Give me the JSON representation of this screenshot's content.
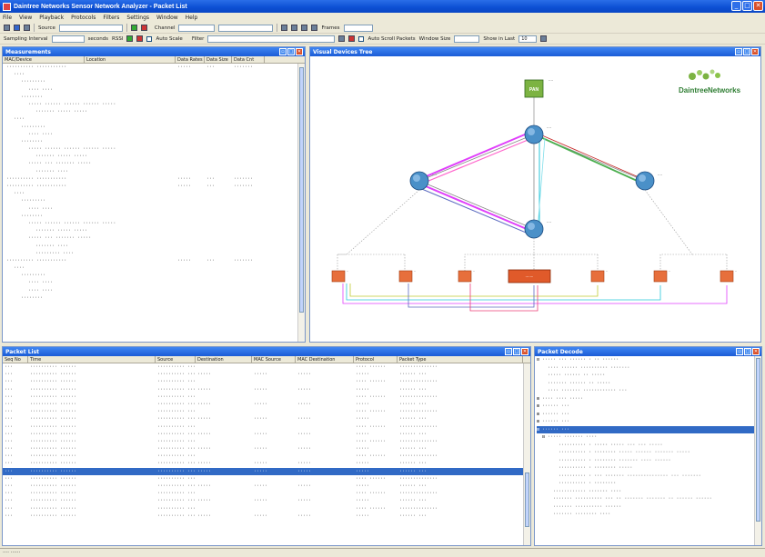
{
  "window": {
    "title": "Daintree Networks Sensor Network Analyzer - Packet List",
    "controls": [
      "_",
      "□",
      "✕"
    ]
  },
  "menu": [
    "File",
    "View",
    "Playback",
    "Protocols",
    "Filters",
    "Settings",
    "Window",
    "Help"
  ],
  "toolbar1": {
    "source_label": "Source",
    "channel_label": "Channel",
    "frames_label": "Frames"
  },
  "toolbar2": {
    "sampling_label": "Sampling Interval",
    "seconds_label": "seconds",
    "rssi_label": "RSSI",
    "autoscale_label": "Auto Scale",
    "filter_label": "Filter",
    "autoscroll_label": "Auto Scroll Packets",
    "window_size_label": "Window Size",
    "show_label": "Show in Last",
    "show_value": "10"
  },
  "measurements": {
    "title": "Measurements",
    "columns": [
      "MAC/Device",
      "Location",
      "Data Rates",
      "Data Size",
      "Data Cnt"
    ],
    "rows": [
      {
        "indent": 0,
        "text": "·········· ···········",
        "v1": "·····",
        "v2": "···",
        "v3": "·······"
      },
      {
        "indent": 1,
        "text": "····",
        "v1": "",
        "v2": "",
        "v3": ""
      },
      {
        "indent": 2,
        "text": "·········",
        "v1": "",
        "v2": "",
        "v3": ""
      },
      {
        "indent": 3,
        "text": "···· ····",
        "v1": "",
        "v2": "",
        "v3": ""
      },
      {
        "indent": 2,
        "text": "········",
        "v1": "",
        "v2": "",
        "v3": ""
      },
      {
        "indent": 3,
        "text": "····· ······ ······ ······ ·····",
        "v1": "",
        "v2": "",
        "v3": ""
      },
      {
        "indent": 4,
        "text": "······· ····· ·····",
        "v1": "",
        "v2": "",
        "v3": ""
      },
      {
        "indent": 1,
        "text": "····",
        "v1": "",
        "v2": "",
        "v3": ""
      },
      {
        "indent": 2,
        "text": "·········",
        "v1": "",
        "v2": "",
        "v3": ""
      },
      {
        "indent": 3,
        "text": "···· ····",
        "v1": "",
        "v2": "",
        "v3": ""
      },
      {
        "indent": 2,
        "text": "········",
        "v1": "",
        "v2": "",
        "v3": ""
      },
      {
        "indent": 3,
        "text": "····· ······ ······ ······ ·····",
        "v1": "",
        "v2": "",
        "v3": ""
      },
      {
        "indent": 4,
        "text": "······· ····· ·····",
        "v1": "",
        "v2": "",
        "v3": ""
      },
      {
        "indent": 3,
        "text": "····· ··· ······· ·····",
        "v1": "",
        "v2": "",
        "v3": ""
      },
      {
        "indent": 4,
        "text": "······· ····",
        "v1": "",
        "v2": "",
        "v3": ""
      },
      {
        "indent": 0,
        "text": "·········· ···········",
        "v1": "·····",
        "v2": "···",
        "v3": "·······"
      },
      {
        "indent": 0,
        "text": "·········· ···········",
        "v1": "·····",
        "v2": "···",
        "v3": "·······"
      },
      {
        "indent": 1,
        "text": "····",
        "v1": "",
        "v2": "",
        "v3": ""
      },
      {
        "indent": 2,
        "text": "·········",
        "v1": "",
        "v2": "",
        "v3": ""
      },
      {
        "indent": 3,
        "text": "···· ····",
        "v1": "",
        "v2": "",
        "v3": ""
      },
      {
        "indent": 2,
        "text": "········",
        "v1": "",
        "v2": "",
        "v3": ""
      },
      {
        "indent": 3,
        "text": "····· ······ ······ ······ ·····",
        "v1": "",
        "v2": "",
        "v3": ""
      },
      {
        "indent": 4,
        "text": "······· ····· ·····",
        "v1": "",
        "v2": "",
        "v3": ""
      },
      {
        "indent": 3,
        "text": "····· ··· ······· ·····",
        "v1": "",
        "v2": "",
        "v3": ""
      },
      {
        "indent": 4,
        "text": "······· ····",
        "v1": "",
        "v2": "",
        "v3": ""
      },
      {
        "indent": 4,
        "text": "········· ····",
        "v1": "",
        "v2": "",
        "v3": ""
      },
      {
        "indent": 0,
        "text": "·········· ···········",
        "v1": "·····",
        "v2": "···",
        "v3": "·······"
      },
      {
        "indent": 1,
        "text": "····",
        "v1": "",
        "v2": "",
        "v3": ""
      },
      {
        "indent": 2,
        "text": "·········",
        "v1": "",
        "v2": "",
        "v3": ""
      },
      {
        "indent": 3,
        "text": "···· ····",
        "v1": "",
        "v2": "",
        "v3": ""
      },
      {
        "indent": 3,
        "text": "···· ····",
        "v1": "",
        "v2": "",
        "v3": ""
      },
      {
        "indent": 2,
        "text": "········",
        "v1": "",
        "v2": "",
        "v3": ""
      }
    ]
  },
  "device_tree": {
    "title": "Visual Devices Tree",
    "logo_text": "DaintreeNetworks",
    "pan_label": "PAN",
    "router_labels": [
      "····",
      "····",
      "····",
      "····"
    ],
    "end_labels": [
      "··",
      "··",
      "··",
      "·······",
      "··",
      "··",
      "··",
      "··"
    ]
  },
  "packet_list": {
    "title": "Packet List",
    "columns": [
      "Seq No",
      "Time",
      "Source",
      "Destination",
      "MAC Source",
      "MAC Destination",
      "Protocol",
      "Packet Type"
    ],
    "selected_index": 14,
    "rows": [
      [
        "···",
        "·········· ······",
        "·········· ······",
        "",
        "",
        "",
        "···· ······",
        "··············"
      ],
      [
        "···",
        "·········· ······",
        "·········· ······",
        "·····",
        "·····",
        "·····",
        "·····",
        "······ ···"
      ],
      [
        "···",
        "·········· ······",
        "·········· ······",
        "",
        "",
        "",
        "···· ······",
        "··············"
      ],
      [
        "···",
        "·········· ······",
        "·········· ······",
        "·····",
        "·····",
        "·····",
        "·····",
        "······ ···"
      ],
      [
        "···",
        "·········· ······",
        "·········· ······",
        "",
        "",
        "",
        "···· ······",
        "··············"
      ],
      [
        "···",
        "·········· ······",
        "·········· ······",
        "·····",
        "·····",
        "·····",
        "·····",
        "······ ···"
      ],
      [
        "···",
        "·········· ······",
        "·········· ······",
        "",
        "",
        "",
        "···· ······",
        "··············"
      ],
      [
        "···",
        "·········· ······",
        "·········· ······",
        "·····",
        "·····",
        "·····",
        "·····",
        "······ ···"
      ],
      [
        "···",
        "·········· ······",
        "·········· ······",
        "",
        "",
        "",
        "···· ······",
        "··············"
      ],
      [
        "···",
        "·········· ······",
        "·········· ······",
        "·····",
        "·····",
        "·····",
        "·····",
        "······ ···"
      ],
      [
        "···",
        "·········· ······",
        "·········· ······",
        "",
        "",
        "",
        "···· ······",
        "··············"
      ],
      [
        "···",
        "·········· ······",
        "·········· ······",
        "·····",
        "·····",
        "·····",
        "·····",
        "······ ···"
      ],
      [
        "···",
        "·········· ······",
        "·········· ······",
        "",
        "",
        "",
        "···· ······",
        "··············"
      ],
      [
        "···",
        "·········· ······",
        "·········· ······",
        "·····",
        "·····",
        "·····",
        "·····",
        "······ ···"
      ],
      [
        "···",
        "·········· ······",
        "·········· ······",
        "·····",
        "·····",
        "·····",
        "·····",
        "······ ···"
      ],
      [
        "···",
        "·········· ······",
        "·········· ······",
        "",
        "",
        "",
        "···· ······",
        "··············"
      ],
      [
        "···",
        "·········· ······",
        "·········· ······",
        "·····",
        "·····",
        "·····",
        "·····",
        "······ ···"
      ],
      [
        "···",
        "·········· ······",
        "·········· ······",
        "",
        "",
        "",
        "···· ······",
        "··············"
      ],
      [
        "···",
        "·········· ······",
        "·········· ······",
        "·····",
        "·····",
        "·····",
        "·····",
        "······ ···"
      ],
      [
        "···",
        "·········· ······",
        "·········· ······",
        "",
        "",
        "",
        "···· ······",
        "··············"
      ],
      [
        "···",
        "·········· ······",
        "·········· ······",
        "·····",
        "·····",
        "·····",
        "·····",
        "······ ···"
      ]
    ]
  },
  "packet_decode": {
    "title": "Packet Decode",
    "selected_index": 9,
    "rows": [
      "⊟ ····· ··· ······ · ·· ······",
      "    ···· ······ ·········· ·······",
      "    ····· ······ ·· ·····",
      "    ······· ······ ·· ·····",
      "    ···· ······· ············ ···",
      "⊞ ···· ···· ·····",
      "⊞ ······ ···",
      "⊞ ······ ···",
      "⊞ ······ ···",
      "⊟ ······ ···",
      "  ⊟ ····· ······· ····",
      "        ·········· · ····· ····· ··· ··· ·····",
      "        ·········· · ········ ····· ······ ······· ·····",
      "        ·········· · ········ ······· ···· ······",
      "        ·········· · ········ ·····",
      "        ·········· · ··· ······· ··············· ··· ·······",
      "        ·········· · ········",
      "      ············ ······· ····",
      "      ······· ·········· ··· ·· ······· ······· ·· ······ ······",
      "      ······· ·········· ······",
      "      ······· ········ ····"
    ]
  },
  "statusbar": {
    "text": "···· ······"
  }
}
